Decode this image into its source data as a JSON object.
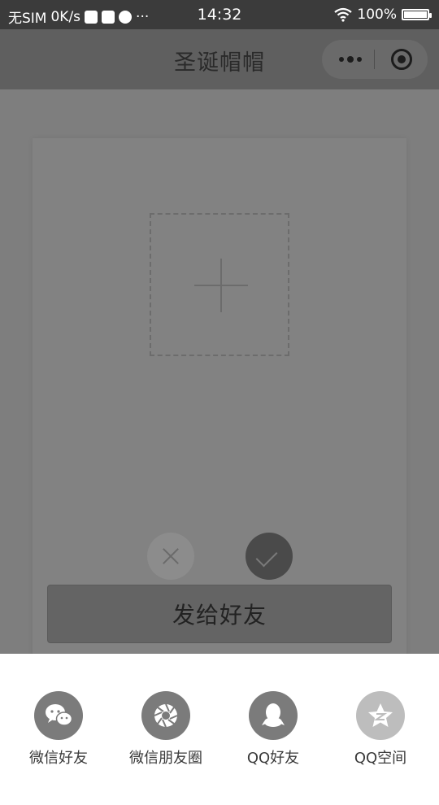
{
  "status_bar": {
    "carrier": "无SIM",
    "speed": "0K/s",
    "more": "···",
    "time": "14:32",
    "battery": "100%"
  },
  "nav": {
    "title": "圣诞帽帽",
    "more_icon": "more-dots-icon",
    "close_icon": "target-circle-icon"
  },
  "editor": {
    "upload_icon": "plus-icon",
    "cancel_icon": "close-icon",
    "confirm_icon": "check-icon",
    "send_label": "发给好友"
  },
  "share": {
    "items": [
      {
        "label": "微信好友",
        "icon": "wechat-icon"
      },
      {
        "label": "微信朋友圈",
        "icon": "moments-icon"
      },
      {
        "label": "QQ好友",
        "icon": "qq-icon"
      },
      {
        "label": "QQ空间",
        "icon": "qzone-icon"
      }
    ]
  },
  "colors": {
    "overlay": "#7e7e7e",
    "status_bar": "#3b3b3b",
    "nav_bar": "#5f5f5f",
    "sheet": "#ffffff",
    "icon_dark": "#7b7b7b",
    "icon_light": "#bdbdbd"
  }
}
